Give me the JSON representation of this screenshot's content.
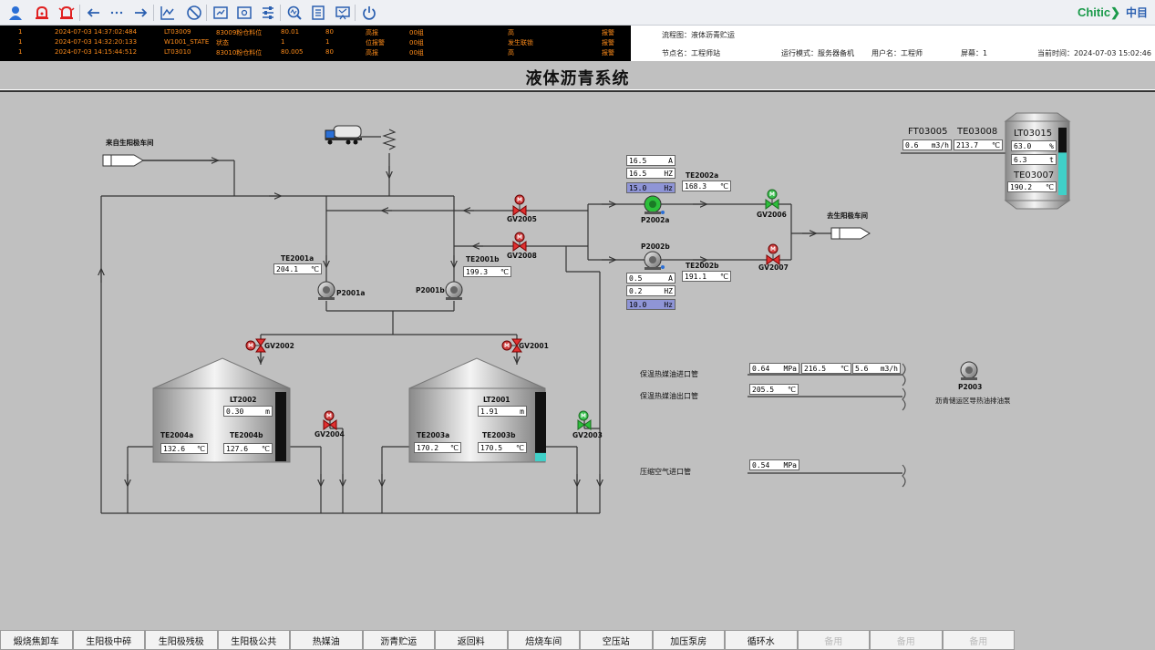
{
  "brand": {
    "name": "Chitic",
    "cn": "中目"
  },
  "alarms": [
    {
      "idx": "1",
      "time": "2024-07-03  14:37:02:484",
      "tag": "LT03009",
      "desc": "83009粉仓料位",
      "value": "80.01",
      "limit": "80",
      "type": "高报",
      "group": "00组",
      "level": "高",
      "status": "报警"
    },
    {
      "idx": "1",
      "time": "2024-07-03  14:32:20:133",
      "tag": "W1001_STATE",
      "desc": "状态",
      "value": "1",
      "limit": "1",
      "type": "位报警",
      "group": "00组",
      "level": "发生联锁",
      "status": "报警"
    },
    {
      "idx": "1",
      "time": "2024-07-03  14:15:44:512",
      "tag": "LT03010",
      "desc": "83010粉仓料位",
      "value": "80.005",
      "limit": "80",
      "type": "高报",
      "group": "00组",
      "level": "高",
      "status": "报警"
    }
  ],
  "info": {
    "flow": "流程图：液体沥青贮运",
    "node": "节点名：工程师站",
    "mode": "运行模式：服务器备机",
    "user": "用户名：工程师",
    "screen": "屏幕：1",
    "time": "当前时间：2024-07-03 15:02:46"
  },
  "page_title": "液体沥青系统",
  "labels": {
    "from_workshop": "来自生阳极车间",
    "to_workshop": "去生阳极车间",
    "gv2005": "GV2005",
    "gv2008": "GV2008",
    "gv2006": "GV2006",
    "gv2007": "GV2007",
    "gv2002": "GV2002",
    "gv2001": "GV2001",
    "gv2004": "GV2004",
    "gv2003": "GV2003",
    "p2001a": "P2001a",
    "p2001b": "P2001b",
    "p2002a": "P2002a",
    "p2002b": "P2002b",
    "p2003": "P2003",
    "te2001a": "TE2001a",
    "te2001b": "TE2001b",
    "te2002a": "TE2002a",
    "te2002b": "TE2002b",
    "lt2002": "LT2002",
    "lt2001": "LT2001",
    "te2004a": "TE2004a",
    "te2004b": "TE2004b",
    "te2003a": "TE2003a",
    "te2003b": "TE2003b",
    "ft03005": "FT03005",
    "te03008": "TE03008",
    "lt03015": "LT03015",
    "te03007": "TE03007",
    "oil_in": "保温热媒油进口管",
    "oil_out": "保温热媒油出口管",
    "air_in": "压缩空气进口管",
    "p2003_desc": "沥青储运区导热油排油泵",
    "m": "M"
  },
  "values": {
    "p2002a_a": {
      "v": "16.5",
      "u": "A"
    },
    "p2002a_hz": {
      "v": "16.5",
      "u": "HZ"
    },
    "p2002a_hz2": {
      "v": "15.0",
      "u": "Hz"
    },
    "te2002a": {
      "v": "168.3",
      "u": "℃"
    },
    "te2002b": {
      "v": "191.1",
      "u": "℃"
    },
    "p2002b_a": {
      "v": "0.5",
      "u": "A"
    },
    "p2002b_hz": {
      "v": "0.2",
      "u": "HZ"
    },
    "p2002b_hz2": {
      "v": "10.0",
      "u": "Hz"
    },
    "te2001a": {
      "v": "204.1",
      "u": "℃"
    },
    "te2001b": {
      "v": "199.3",
      "u": "℃"
    },
    "lt2002": {
      "v": "0.30",
      "u": "m"
    },
    "lt2001": {
      "v": "1.91",
      "u": "m"
    },
    "te2004a": {
      "v": "132.6",
      "u": "℃"
    },
    "te2004b": {
      "v": "127.6",
      "u": "℃"
    },
    "te2003a": {
      "v": "170.2",
      "u": "℃"
    },
    "te2003b": {
      "v": "170.5",
      "u": "℃"
    },
    "ft03005": {
      "v": "0.6",
      "u": "m3/h"
    },
    "te03008": {
      "v": "213.7",
      "u": "℃"
    },
    "lt03015_pct": {
      "v": "63.0",
      "u": "%"
    },
    "lt03015_t": {
      "v": "6.3",
      "u": "t"
    },
    "te03007": {
      "v": "190.2",
      "u": "℃"
    },
    "oil_in_p": {
      "v": "0.64",
      "u": "MPa"
    },
    "oil_in_t": {
      "v": "216.5",
      "u": "℃"
    },
    "oil_in_f": {
      "v": "5.6",
      "u": "m3/h"
    },
    "oil_out_t": {
      "v": "205.5",
      "u": "℃"
    },
    "air_p": {
      "v": "0.54",
      "u": "MPa"
    }
  },
  "levels": {
    "lt2002": 0.0,
    "lt2001": 0.12,
    "lt03015": 0.63
  },
  "colors": {
    "valve_open": "#2bbf3a",
    "valve_closed": "#e03030",
    "pump_on": "#2bbf3a",
    "level_fill": "#40d0c8",
    "alarm_text": "#ff8c1a"
  },
  "nav": [
    {
      "label": "煅烧焦卸车",
      "enabled": true
    },
    {
      "label": "生阳极中碎",
      "enabled": true
    },
    {
      "label": "生阳极残极",
      "enabled": true
    },
    {
      "label": "生阳极公共",
      "enabled": true
    },
    {
      "label": "热媒油",
      "enabled": true
    },
    {
      "label": "沥青贮运",
      "enabled": true
    },
    {
      "label": "返回料",
      "enabled": true
    },
    {
      "label": "焙烧车间",
      "enabled": true
    },
    {
      "label": "空压站",
      "enabled": true
    },
    {
      "label": "加压泵房",
      "enabled": true
    },
    {
      "label": "循环水",
      "enabled": true
    },
    {
      "label": "备用",
      "enabled": false
    },
    {
      "label": "备用",
      "enabled": false
    },
    {
      "label": "备用",
      "enabled": false
    }
  ],
  "toolbar_icons": [
    "user-icon",
    "alarm-icon",
    "alarm-list-icon",
    "back-icon",
    "more-icon",
    "forward-icon",
    "trend-icon",
    "stop-icon",
    "report-icon",
    "config-icon",
    "settings-icon",
    "diagnose-icon",
    "log-icon",
    "screen-icon",
    "power-icon"
  ]
}
